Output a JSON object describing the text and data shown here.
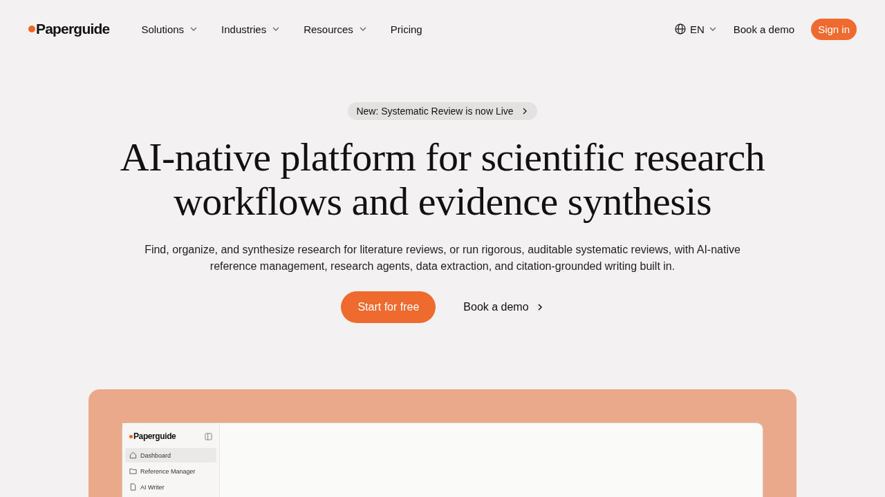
{
  "nav": {
    "logo": "Paperguide",
    "menus": [
      {
        "label": "Solutions",
        "dropdown": true
      },
      {
        "label": "Industries",
        "dropdown": true
      },
      {
        "label": "Resources",
        "dropdown": true
      },
      {
        "label": "Pricing",
        "dropdown": false
      }
    ],
    "language": "EN",
    "demo": "Book a demo",
    "sign_in": "Sign in"
  },
  "hero": {
    "badge": "New: Systematic Review is now Live",
    "title": "AI-native platform for scientific research workflows and evidence synthesis",
    "subtitle": "Find, organize, and synthesize research for literature reviews, or run rigorous, auditable systematic reviews, with AI-native reference management, research agents, data extraction, and citation-grounded writing built in.",
    "primary": "Start for free",
    "secondary": "Book a demo"
  },
  "app_preview": {
    "logo": "Paperguide",
    "sidebar": [
      {
        "label": "Dashboard",
        "kind": "home",
        "selected": true
      },
      {
        "label": "Reference Manager",
        "kind": "folder",
        "selected": false
      },
      {
        "label": "AI Writer",
        "kind": "doc",
        "selected": false
      }
    ]
  }
}
